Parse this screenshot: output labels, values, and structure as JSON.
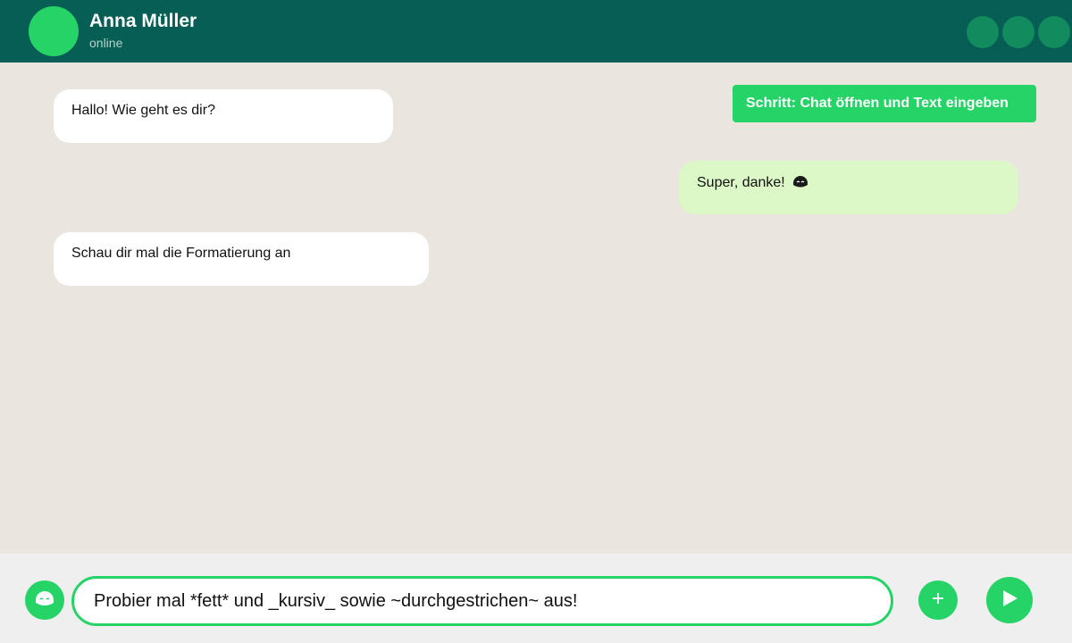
{
  "header": {
    "contact_name": "Anna Müller",
    "status": "online",
    "background": "#075e54",
    "avatar_color": "#25d366",
    "action_buttons": [
      "header-action-1",
      "header-action-2",
      "header-action-3"
    ]
  },
  "step_label": "Schritt: Chat öffnen und Text eingeben",
  "messages": [
    {
      "direction": "incoming",
      "text": "Hallo! Wie geht es dir?"
    },
    {
      "direction": "outgoing",
      "text": "Super, danke!",
      "emoji": "smiling-face-icon"
    },
    {
      "direction": "incoming",
      "text": "Schau dir mal die Formatierung an"
    }
  ],
  "composer": {
    "input_value": "Probier mal *fett* und _kursiv_ sowie ~durchgestrichen~ aus!",
    "emoji_icon": "smiley-icon",
    "attach_icon": "plus-icon",
    "send_icon": "send-icon"
  },
  "colors": {
    "accent": "#25d366",
    "chat_background": "#ebe5df",
    "incoming_bubble": "#ffffff",
    "outgoing_bubble": "#dcf8c6"
  }
}
